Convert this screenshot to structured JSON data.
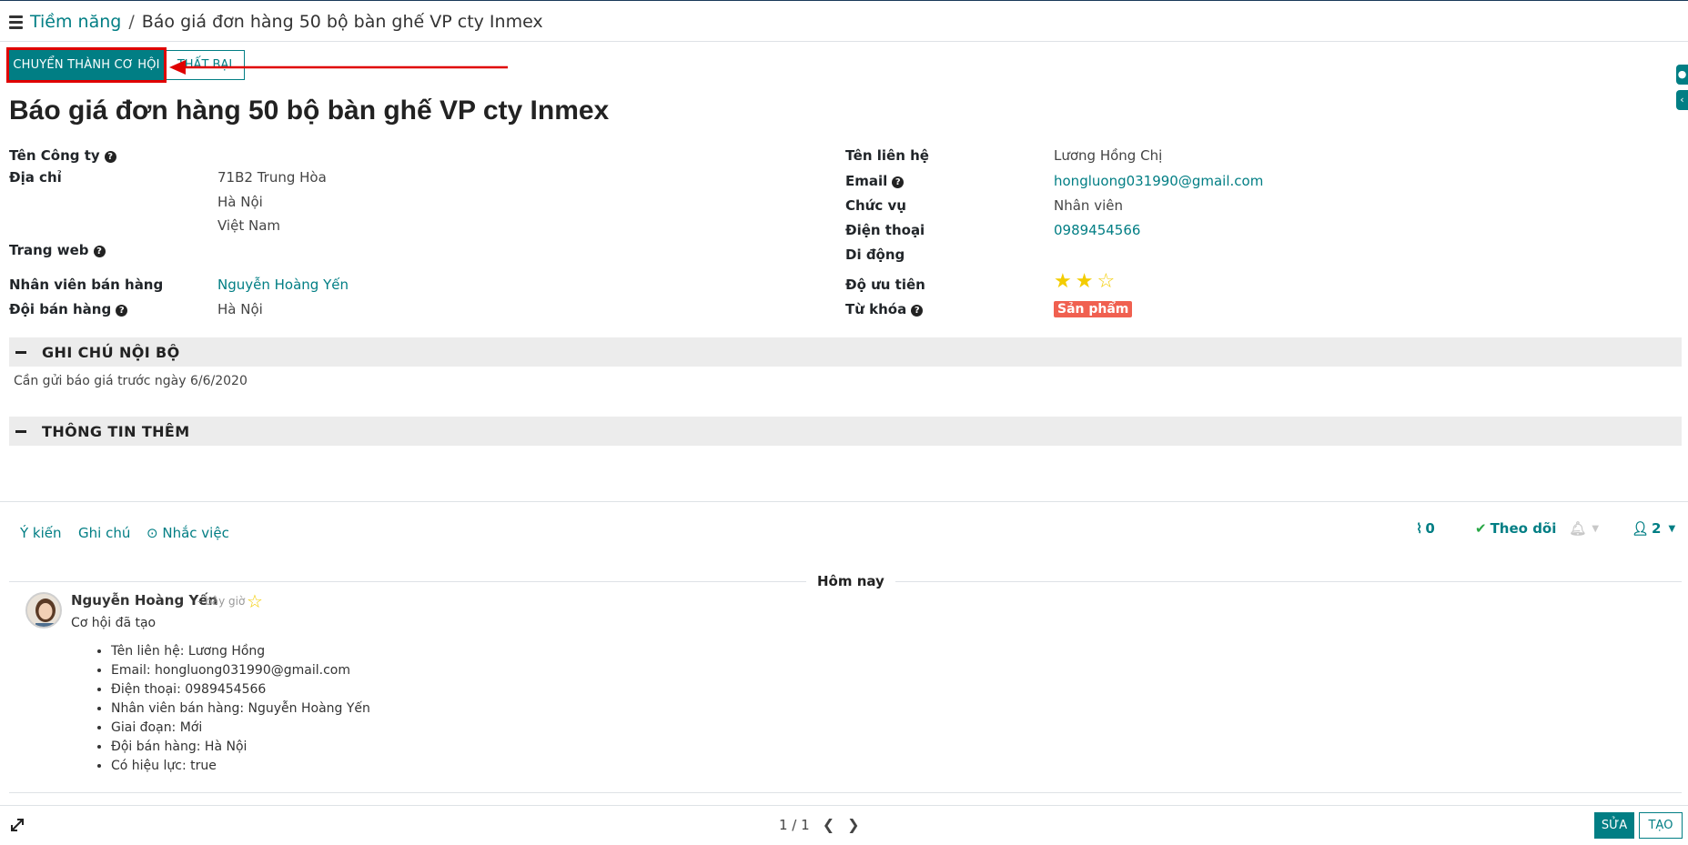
{
  "breadcrumb": {
    "parent": "Tiềm năng",
    "separator": "/",
    "current": "Báo giá đơn hàng 50 bộ bàn ghế VP cty Inmex"
  },
  "statusbar": {
    "convert_label": "CHUYỂN THÀNH CƠ HỘI",
    "lost_label": "THẤT BẠI"
  },
  "record": {
    "title": "Báo giá đơn hàng 50 bộ bàn ghế VP cty Inmex"
  },
  "left_fields": {
    "company_label": "Tên Công ty",
    "address_label": "Địa chỉ",
    "address_line1": "71B2 Trung Hòa",
    "address_line2": "Hà Nội",
    "address_line3": "Việt Nam",
    "website_label": "Trang web",
    "salesperson_label": "Nhân viên bán hàng",
    "salesperson_value": "Nguyễn Hoàng Yến",
    "team_label": "Đội bán hàng",
    "team_value": "Hà Nội"
  },
  "right_fields": {
    "contact_label": "Tên liên hệ",
    "contact_value": "Lương Hồng Chị",
    "email_label": "Email",
    "email_value": "hongluong031990@gmail.com",
    "job_label": "Chức vụ",
    "job_value": "Nhân viên",
    "phone_label": "Điện thoại",
    "phone_value": "0989454566",
    "mobile_label": "Di động",
    "priority_label": "Độ ưu tiên",
    "priority_value": 2,
    "priority_max": 3,
    "tags_label": "Từ khóa",
    "tag_value": "Sản phẩm",
    "tag_color": "#f06050"
  },
  "sections": {
    "internal_notes": "GHI CHÚ NỘI BỘ",
    "internal_notes_text": "Cần gửi báo giá trước ngày 6/6/2020",
    "extra_info": "THÔNG TIN THÊM"
  },
  "chatter": {
    "tab_message": "Ý kiến",
    "tab_note": "Ghi chú",
    "tab_activity": "Nhắc việc",
    "attachments_count": "0",
    "follow_label": "Theo dõi",
    "followers_count": "2",
    "today_label": "Hôm nay",
    "message": {
      "author": "Nguyễn Hoàng Yến",
      "time": "- bây giờ",
      "body": "Cơ hội đã tạo",
      "items": [
        "Tên liên hệ: Lương Hồng",
        "Email: hongluong031990@gmail.com",
        "Điện thoại: 0989454566",
        "Nhân viên bán hàng: Nguyễn Hoàng Yến",
        "Giai đoạn: Mới",
        "Đội bán hàng: Hà Nội",
        "Có hiệu lực: true"
      ]
    }
  },
  "pager": {
    "value": "1 / 1"
  },
  "footer": {
    "edit_label": "SỬA",
    "create_label": "TẠO"
  },
  "colors": {
    "primary": "#017e84",
    "highlight": "#e00000",
    "star": "#f3cc00"
  }
}
